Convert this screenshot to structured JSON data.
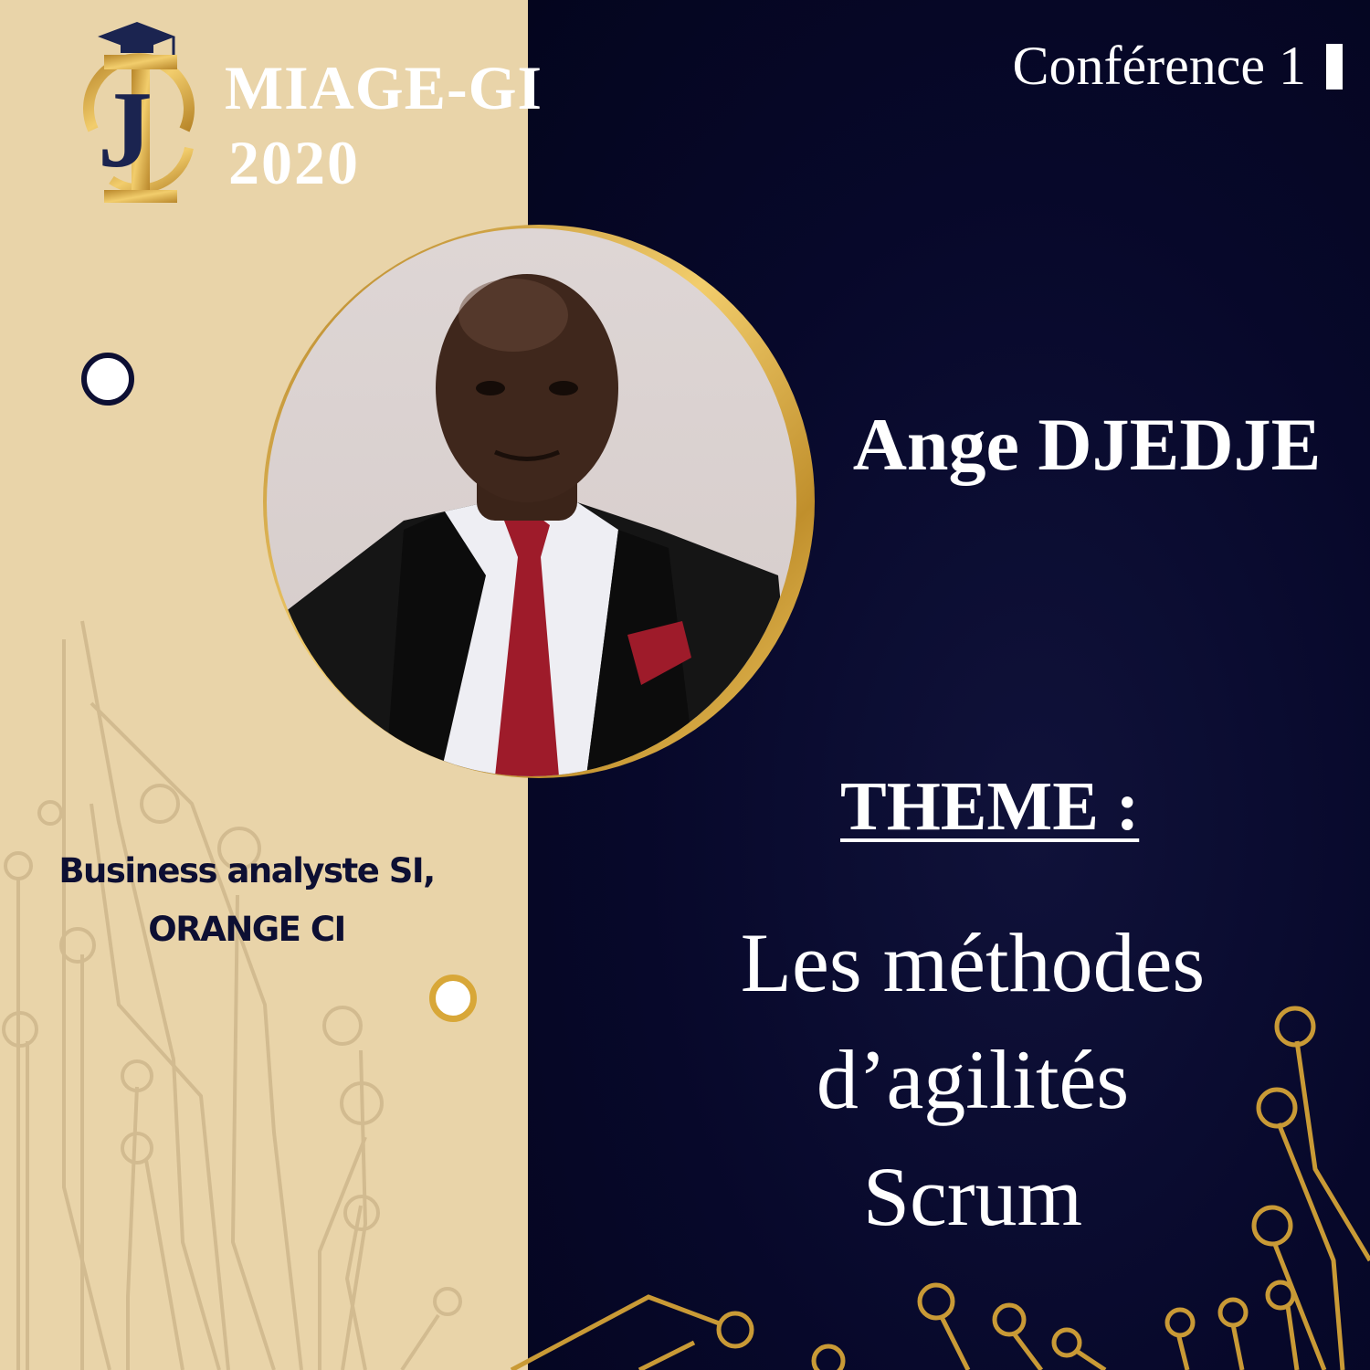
{
  "brand": {
    "name": "MIAGE-GI",
    "year": "2020",
    "logo_icon": "jig-graduation-cap-logo-icon"
  },
  "conference": {
    "label": "Conférence 1"
  },
  "speaker": {
    "name": "Ange DJEDJE",
    "role_line1": "Business analyste SI,",
    "role_line2": "ORANGE CI",
    "photo_icon": "speaker-portrait"
  },
  "theme": {
    "label": "THEME :",
    "title_line1": "Les méthodes d’agilités",
    "title_line2": "Scrum"
  },
  "colors": {
    "navy": "#07082a",
    "gold": "#d8a738",
    "beige": "#e9d4a9",
    "white": "#ffffff"
  }
}
